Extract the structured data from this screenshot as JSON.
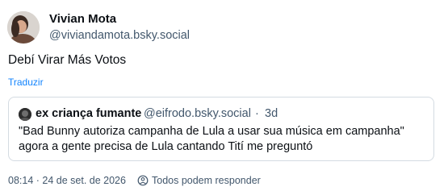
{
  "author": {
    "display_name": "Vivian Mota",
    "handle": "@viviandamota.bsky.social",
    "avatar_icon": "user-avatar-photo"
  },
  "post": {
    "text": "Debí Virar Más Votos",
    "translate_label": "Traduzir"
  },
  "quote": {
    "display_name": "ex criança fumante",
    "handle": "@eifrodo.bsky.social",
    "separator": "·",
    "time": "3d",
    "line1": "\"Bad Bunny autoriza campanha de Lula a usar sua música em campanha\"",
    "line2": "agora a gente precisa de Lula cantando Tití me preguntó",
    "avatar_icon": "user-avatar-photo"
  },
  "meta": {
    "timestamp": "08:14 · 24 de set. de 2026",
    "reply_icon": "reply-settings-icon",
    "reply_setting": "Todos podem responder"
  },
  "colors": {
    "text_primary": "#0b0f14",
    "text_secondary": "#42576c",
    "link": "#1083fe",
    "border": "#d4dbe2"
  }
}
